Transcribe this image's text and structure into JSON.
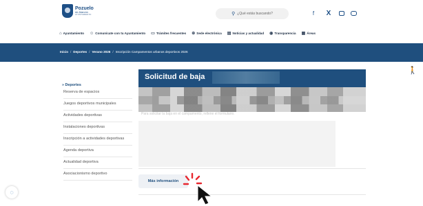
{
  "header": {
    "logo_title": "Pozuelo",
    "logo_subtitle": "de Alarcón",
    "logo_tagline": "AYUNTAMIENTO",
    "search_placeholder": "¿Qué estás buscando?",
    "social": [
      {
        "icon": "facebook-icon",
        "glyph": "f"
      },
      {
        "icon": "x-icon",
        "glyph": "X"
      },
      {
        "icon": "instagram-icon",
        "glyph": ""
      },
      {
        "icon": "youtube-icon",
        "glyph": ""
      }
    ]
  },
  "topnav": [
    {
      "label": "Ayuntamiento",
      "icon": "⌂",
      "icon_name": "building-icon"
    },
    {
      "label": "Comunícate con tu Ayuntamiento",
      "icon": "☺",
      "icon_name": "people-icon"
    },
    {
      "label": "Trámites frecuentes",
      "icon": "▭",
      "icon_name": "folder-icon"
    },
    {
      "label": "Sede electrónica",
      "icon": "⊕",
      "icon_name": "globe-icon"
    },
    {
      "label": "Noticias y actualidad",
      "icon": "▤",
      "icon_name": "news-icon"
    },
    {
      "label": "Transparencia",
      "icon": "◉",
      "icon_name": "eye-icon"
    },
    {
      "label": "Áreas",
      "icon": "▦",
      "icon_name": "grid-icon"
    }
  ],
  "breadcrumb": [
    {
      "label": "Inicio",
      "bold": true
    },
    {
      "label": "Deportes",
      "bold": true
    },
    {
      "label": "Verano 2026",
      "bold": true
    },
    {
      "label": "Inscripción Campamentos urbanos deportivos 2026",
      "bold": false
    }
  ],
  "sidebar": {
    "heading": "» Deportes",
    "items": [
      "Reserva de espacios",
      "Juegos deportivos municipales",
      "Actividades deportivas",
      "Instalaciones deportivas",
      "Inscripción a actividades deportivas",
      "Agenda deportiva",
      "Actualidad deportiva",
      "Asociacionismo deportivo"
    ]
  },
  "main": {
    "title": "Solicitud de baja",
    "faint_text": "Para solicitar la baja en el campamento, rellene el formulario.",
    "more_info_label": "Más información"
  },
  "colors": {
    "brand_blue": "#1f4f7e",
    "click_red": "#e8262e"
  }
}
